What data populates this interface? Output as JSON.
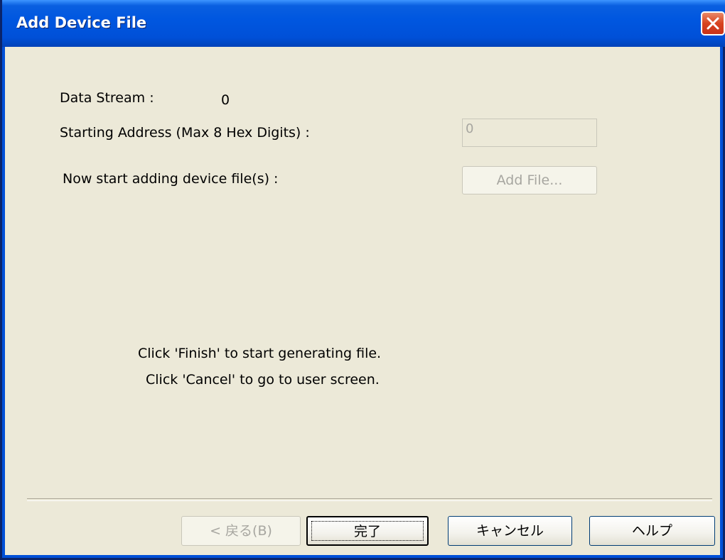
{
  "window": {
    "title": "Add Device File"
  },
  "form": {
    "data_stream_label": "Data Stream :",
    "data_stream_value": "0",
    "starting_address_label": "Starting Address (Max 8 Hex Digits) :",
    "starting_address_value": "0",
    "add_files_label": "Now start adding device file(s) :",
    "add_file_button": "Add File..."
  },
  "instructions": {
    "line1": "Click 'Finish' to start generating file.",
    "line2": "Click 'Cancel' to go to user screen."
  },
  "footer": {
    "back_button": "< 戻る(B)",
    "finish_button": "完了",
    "cancel_button": "キャンセル",
    "help_button": "ヘルプ"
  },
  "colors": {
    "titlebar": "#0050d8",
    "dialog_bg": "#ece9d8",
    "close_button": "#d8431f"
  }
}
